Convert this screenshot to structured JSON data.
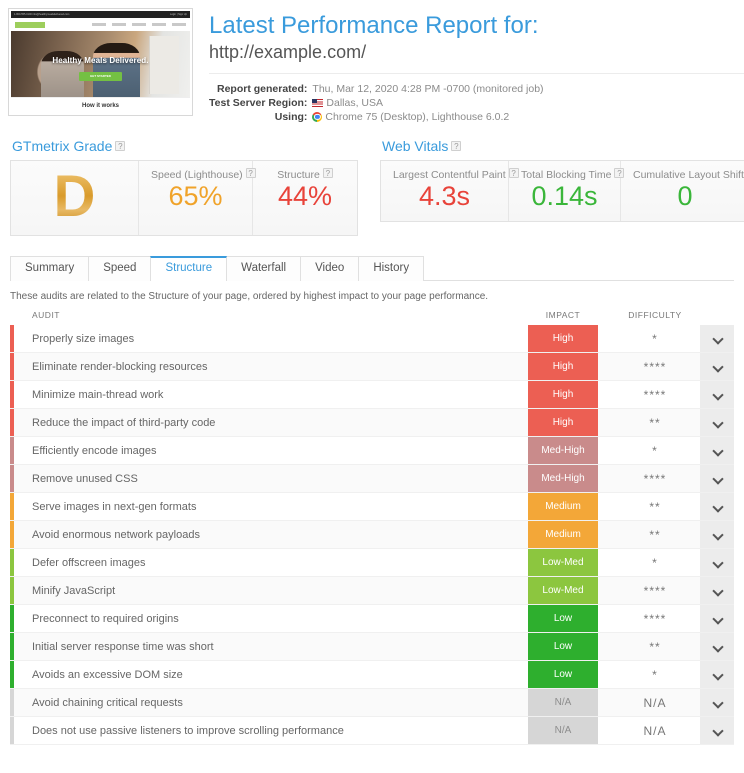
{
  "thumbnail": {
    "topbar_left": "1-800-555-0100   info@healthymealsdelivered.com",
    "topbar_right": "Login  |  Sign Up",
    "headline": "Healthy Meals Delivered.",
    "cta": "GET STARTED",
    "footer_caption": "How it works"
  },
  "header": {
    "title": "Latest Performance Report for:",
    "url": "http://example.com/",
    "meta": [
      {
        "label": "Report generated:",
        "value": "Thu, Mar 12, 2020 4:28 PM -0700 (monitored job)",
        "icon": ""
      },
      {
        "label": "Test Server Region:",
        "value": "Dallas, USA",
        "icon": "us-flag-icon"
      },
      {
        "label": "Using:",
        "value": "Chrome 75 (Desktop), Lighthouse 6.0.2",
        "icon": "chrome-icon"
      }
    ]
  },
  "gtmetrix_grade": {
    "heading": "GTmetrix Grade",
    "grade": "D",
    "metrics": [
      {
        "label": "Speed (Lighthouse)",
        "value": "65%",
        "color": "#f0a32a"
      },
      {
        "label": "Structure",
        "value": "44%",
        "color": "#e8433a"
      }
    ]
  },
  "web_vitals": {
    "heading": "Web Vitals",
    "metrics": [
      {
        "label": "Largest Contentful Paint",
        "value": "4.3s",
        "color": "#e8433a"
      },
      {
        "label": "Total Blocking Time",
        "value": "0.14s",
        "color": "#3ab63a"
      },
      {
        "label": "Cumulative Layout Shift",
        "value": "0",
        "color": "#3ab63a"
      }
    ]
  },
  "tabs": [
    {
      "label": "Summary",
      "active": false
    },
    {
      "label": "Speed",
      "active": false
    },
    {
      "label": "Structure",
      "active": true
    },
    {
      "label": "Waterfall",
      "active": false
    },
    {
      "label": "Video",
      "active": false
    },
    {
      "label": "History",
      "active": false
    }
  ],
  "audits": {
    "intro": "These audits are related to the Structure of your page, ordered by highest impact to your page performance.",
    "columns": {
      "audit": "AUDIT",
      "impact": "IMPACT",
      "difficulty": "DIFFICULTY"
    },
    "colors": {
      "High": "#ec5f53",
      "Med-High": "#c98b8b",
      "Medium": "#f3a738",
      "Low-Med": "#8cc63f",
      "Low": "#2eaf2e",
      "N/A": "#d6d6d6"
    },
    "rows": [
      {
        "name": "Properly size images",
        "impact": "High",
        "difficulty": "*"
      },
      {
        "name": "Eliminate render-blocking resources",
        "impact": "High",
        "difficulty": "****"
      },
      {
        "name": "Minimize main-thread work",
        "impact": "High",
        "difficulty": "****"
      },
      {
        "name": "Reduce the impact of third-party code",
        "impact": "High",
        "difficulty": "**"
      },
      {
        "name": "Efficiently encode images",
        "impact": "Med-High",
        "difficulty": "*"
      },
      {
        "name": "Remove unused CSS",
        "impact": "Med-High",
        "difficulty": "****"
      },
      {
        "name": "Serve images in next-gen formats",
        "impact": "Medium",
        "difficulty": "**"
      },
      {
        "name": "Avoid enormous network payloads",
        "impact": "Medium",
        "difficulty": "**"
      },
      {
        "name": "Defer offscreen images",
        "impact": "Low-Med",
        "difficulty": "*"
      },
      {
        "name": "Minify JavaScript",
        "impact": "Low-Med",
        "difficulty": "****"
      },
      {
        "name": "Preconnect to required origins",
        "impact": "Low",
        "difficulty": "****"
      },
      {
        "name": "Initial server response time was short",
        "impact": "Low",
        "difficulty": "**"
      },
      {
        "name": "Avoids an excessive DOM size",
        "impact": "Low",
        "difficulty": "*"
      },
      {
        "name": "Avoid chaining critical requests",
        "impact": "N/A",
        "difficulty": "N/A"
      },
      {
        "name": "Does not use passive listeners to improve scrolling performance",
        "impact": "N/A",
        "difficulty": "N/A"
      }
    ]
  }
}
